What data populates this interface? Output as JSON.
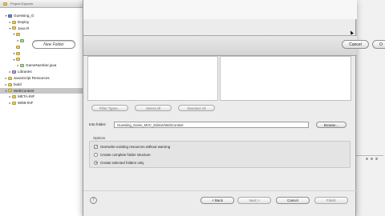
{
  "explorer": {
    "title": "Project Explorer",
    "tree": [
      {
        "label": "Guessing_G",
        "indent": 1,
        "icon": "project",
        "twisty": "▾"
      },
      {
        "label": "Deploy",
        "indent": 2,
        "icon": "folder",
        "twisty": "▸"
      },
      {
        "label": "Java R",
        "indent": 2,
        "icon": "folder",
        "twisty": "▾"
      },
      {
        "label": "",
        "indent": 3,
        "icon": "folder",
        "twisty": "▾"
      },
      {
        "label": "",
        "indent": 4,
        "icon": "java",
        "twisty": "▸"
      },
      {
        "label": "",
        "indent": 3,
        "icon": "folder",
        "twisty": ""
      },
      {
        "label": "",
        "indent": 3,
        "icon": "folder",
        "twisty": "▾"
      },
      {
        "label": "",
        "indent": 3,
        "icon": "folder",
        "twisty": "▾"
      },
      {
        "label": "GameNumber.java",
        "indent": 4,
        "icon": "java",
        "twisty": "▸"
      },
      {
        "label": "Libraries",
        "indent": 2,
        "icon": "lib",
        "twisty": "▸"
      },
      {
        "label": "JavaScript Resources",
        "indent": 1,
        "icon": "folder",
        "twisty": "▸"
      },
      {
        "label": "build",
        "indent": 1,
        "icon": "folder",
        "twisty": "▸"
      },
      {
        "label": "WebContent",
        "indent": 1,
        "icon": "folder",
        "twisty": "▾",
        "selected": true
      },
      {
        "label": "META-INF",
        "indent": 2,
        "icon": "folder",
        "twisty": "▸"
      },
      {
        "label": "WEB-INF",
        "indent": 2,
        "icon": "folder",
        "twisty": "▸"
      }
    ]
  },
  "new_folder": {
    "field_label": "New Folder",
    "cancel_label": "Cancel",
    "ok_label": "O"
  },
  "dialog": {
    "filter_types_label": "Filter Types...",
    "select_all_label": "Select All",
    "deselect_all_label": "Deselect All",
    "into_folder_label": "Into folder:",
    "into_folder_value": "Guessing_Game_MVC_Edition/WebContent",
    "browse_label": "Browse...",
    "options_title": "Options",
    "option_overwrite": "Overwrite existing resources without warning",
    "option_complete": "Create complete folder structure",
    "option_selected": "Create selected folders only",
    "back_label": "< Back",
    "next_label": "Next >",
    "cancel_label": "Cancel",
    "finish_label": "Finish",
    "help_label": "?"
  }
}
